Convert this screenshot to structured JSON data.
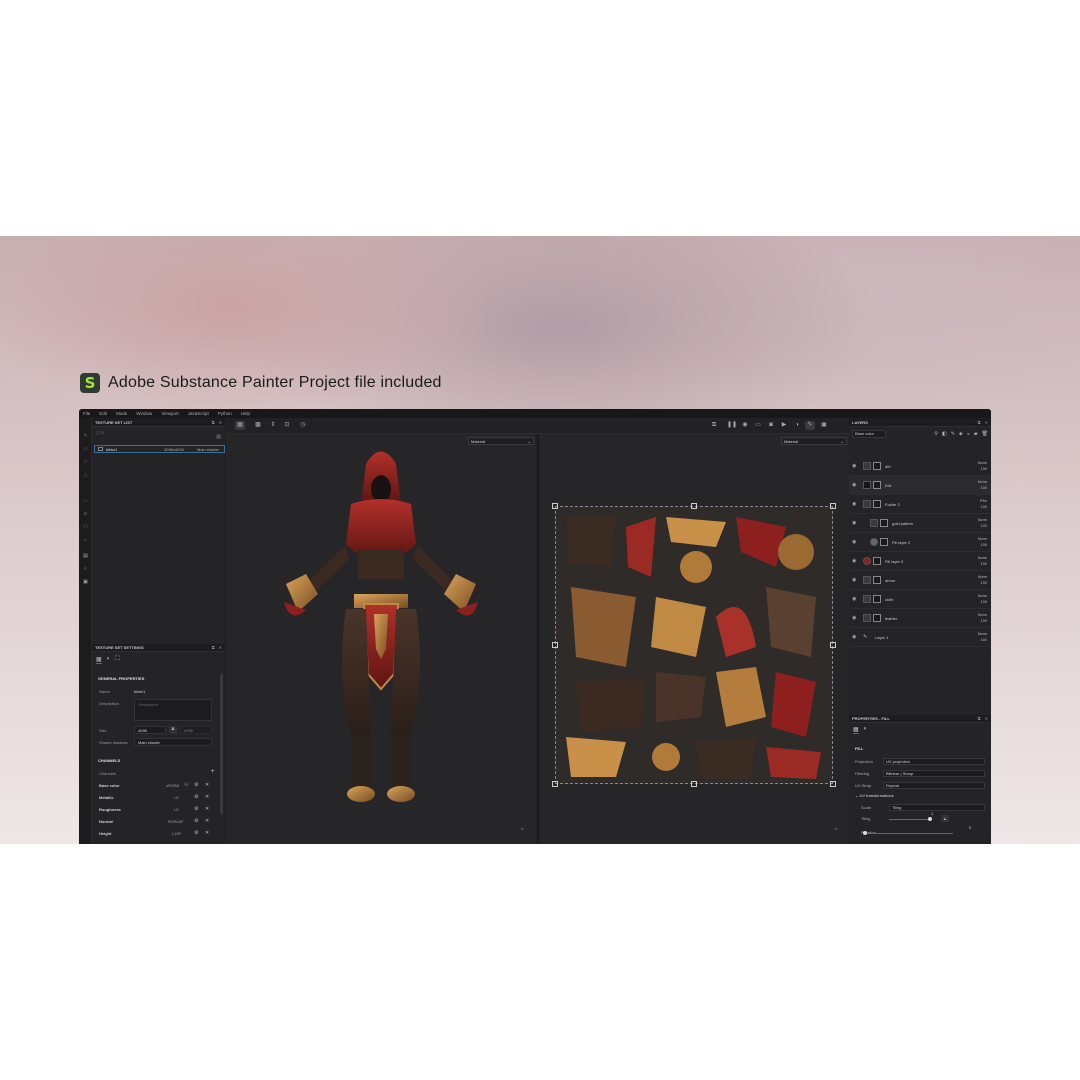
{
  "headline": {
    "text": "Adobe Substance Painter Project file included",
    "logo_letter": "S"
  },
  "menu": [
    "File",
    "Edit",
    "Mode",
    "Window",
    "Viewport",
    "JavaScript",
    "Python",
    "Help"
  ],
  "texture_set_list": {
    "title": "TEXTURE SET LIST",
    "row": {
      "name": "bikini1",
      "size": "4096x4096",
      "shader": "Main shader"
    }
  },
  "texture_set_settings": {
    "title": "TEXTURE SET SETTINGS",
    "general_header": "GENERAL PROPERTIES",
    "name_label": "Name",
    "name_value": "bikini1",
    "description_label": "Description",
    "description_placeholder": "Description",
    "size_label": "Size",
    "size_value": "4096",
    "size_value2": "4096",
    "shader_label": "Shader instance",
    "shader_value": "Main shader",
    "channels_header": "CHANNELS",
    "channels_label": "Channels",
    "channels": [
      {
        "name": "Base color",
        "format": "sRGB8"
      },
      {
        "name": "Metallic",
        "format": "L8"
      },
      {
        "name": "Roughness",
        "format": "L8"
      },
      {
        "name": "Normal",
        "format": "RGB16F"
      },
      {
        "name": "Height",
        "format": "L16F"
      }
    ]
  },
  "viewport": {
    "material_left": "Material",
    "material_right": "Material"
  },
  "layers": {
    "title": "LAYERS",
    "channel_select": "Base color",
    "items": [
      {
        "name": "dirt",
        "blend": "Norm",
        "opacity": "100",
        "type": "folder"
      },
      {
        "name": "Dirt",
        "blend": "Norm",
        "opacity": "100",
        "type": "fill"
      },
      {
        "name": "Folder 2",
        "blend": "Pthr",
        "opacity": "100",
        "type": "folder"
      },
      {
        "name": "gold pattern",
        "blend": "Norm",
        "opacity": "100",
        "type": "folder"
      },
      {
        "name": "Fill layer 2",
        "blend": "Norm",
        "opacity": "100",
        "type": "fill"
      },
      {
        "name": "Fill layer 3",
        "blend": "Norm",
        "opacity": "100",
        "type": "fill"
      },
      {
        "name": "armor",
        "blend": "Norm",
        "opacity": "100",
        "type": "folder"
      },
      {
        "name": "cloth",
        "blend": "Norm",
        "opacity": "100",
        "type": "folder"
      },
      {
        "name": "leather",
        "blend": "Norm",
        "opacity": "100",
        "type": "folder"
      },
      {
        "name": "Layer 1",
        "blend": "Norm",
        "opacity": "100",
        "type": "paint"
      }
    ]
  },
  "properties": {
    "title": "PROPERTIES - FILL",
    "section": "FILL",
    "projection_label": "Projection",
    "projection_value": "UV projection",
    "filtering_label": "Filtering",
    "filtering_value": "Bilinear | Sharp",
    "uvwrap_label": "UV Wrap",
    "uvwrap_value": "Repeat",
    "uvtrans_header": "UV transformations",
    "scale_label": "Scale",
    "scale_value": "Tiling",
    "tiling_label": "Tiling",
    "tiling_value": "1",
    "rotation_label": "Rotation",
    "rotation_value": "0"
  },
  "colors": {
    "accent": "#3b6f9a",
    "cloth_red": "#8e1f1f",
    "gold": "#b07a3a",
    "logo_green": "#a8e23f"
  }
}
